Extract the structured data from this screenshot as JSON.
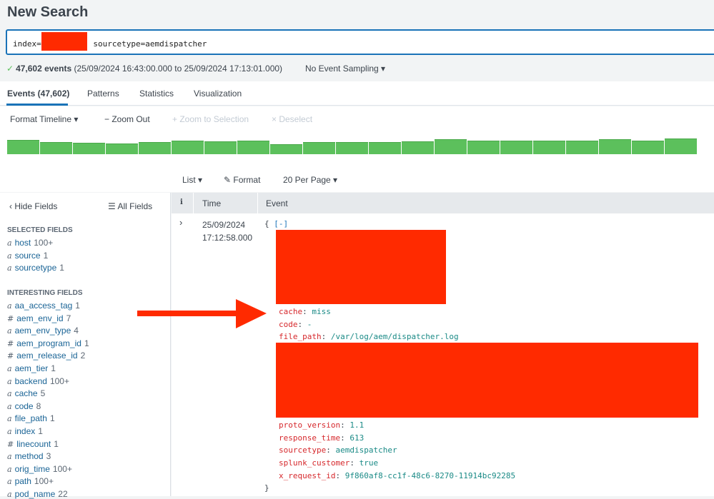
{
  "header": {
    "title": "New Search"
  },
  "search": {
    "prefix": "index=",
    "suffix": "sourcetype=aemdispatcher"
  },
  "status": {
    "count": "47,602 events",
    "range": "(25/09/2024 16:43:00.000 to 25/09/2024 17:13:01.000)",
    "sampling": "No Event Sampling ▾"
  },
  "tabs": [
    {
      "label": "Events (47,602)"
    },
    {
      "label": "Patterns"
    },
    {
      "label": "Statistics"
    },
    {
      "label": "Visualization"
    }
  ],
  "timeline": {
    "format": "Format Timeline ▾",
    "zoom_out": "− Zoom Out",
    "zoom_sel": "+ Zoom to Selection",
    "deselect": "× Deselect",
    "bar_levels": [
      20,
      17,
      16,
      15,
      17,
      19,
      18,
      19,
      14,
      17,
      17,
      17,
      18,
      21,
      19,
      19,
      19,
      19,
      21,
      19,
      22
    ],
    "color": "#5cc05c"
  },
  "view": {
    "list": "List ▾",
    "format": "Format",
    "per_page": "20 Per Page ▾"
  },
  "sidebar": {
    "hide": "Hide Fields",
    "all": "All Fields",
    "selected_title": "SELECTED FIELDS",
    "interesting_title": "INTERESTING FIELDS",
    "selected": [
      {
        "t": "a",
        "n": "host",
        "c": "100+"
      },
      {
        "t": "a",
        "n": "source",
        "c": "1"
      },
      {
        "t": "a",
        "n": "sourcetype",
        "c": "1"
      }
    ],
    "interesting": [
      {
        "t": "a",
        "n": "aa_access_tag",
        "c": "1"
      },
      {
        "t": "#",
        "n": "aem_env_id",
        "c": "7"
      },
      {
        "t": "a",
        "n": "aem_env_type",
        "c": "4"
      },
      {
        "t": "#",
        "n": "aem_program_id",
        "c": "1"
      },
      {
        "t": "#",
        "n": "aem_release_id",
        "c": "2"
      },
      {
        "t": "a",
        "n": "aem_tier",
        "c": "1"
      },
      {
        "t": "a",
        "n": "backend",
        "c": "100+"
      },
      {
        "t": "a",
        "n": "cache",
        "c": "5"
      },
      {
        "t": "a",
        "n": "code",
        "c": "8"
      },
      {
        "t": "a",
        "n": "file_path",
        "c": "1"
      },
      {
        "t": "a",
        "n": "index",
        "c": "1"
      },
      {
        "t": "#",
        "n": "linecount",
        "c": "1"
      },
      {
        "t": "a",
        "n": "method",
        "c": "3"
      },
      {
        "t": "a",
        "n": "orig_time",
        "c": "100+"
      },
      {
        "t": "a",
        "n": "path",
        "c": "100+"
      },
      {
        "t": "a",
        "n": "pod_name",
        "c": "22"
      }
    ]
  },
  "table": {
    "col_i": "i",
    "col_time": "Time",
    "col_event": "Event"
  },
  "event": {
    "date": "25/09/2024",
    "time": "17:12:58.000",
    "open": "{",
    "collapse": "[-]",
    "close": "}",
    "fields_a": [
      {
        "k": "cache",
        "v": "miss"
      },
      {
        "k": "code",
        "v": "-"
      },
      {
        "k": "file_path",
        "v": "/var/log/aem/dispatcher.log"
      }
    ],
    "fields_b": [
      {
        "k": "proto_version",
        "v": "1.1"
      },
      {
        "k": "response_time",
        "v": "613"
      },
      {
        "k": "sourcetype",
        "v": "aemdispatcher"
      },
      {
        "k": "splunk_customer",
        "v": "true"
      },
      {
        "k": "x_request_id",
        "v": "9f860af8-cc1f-48c6-8270-11914bc92285"
      }
    ]
  }
}
